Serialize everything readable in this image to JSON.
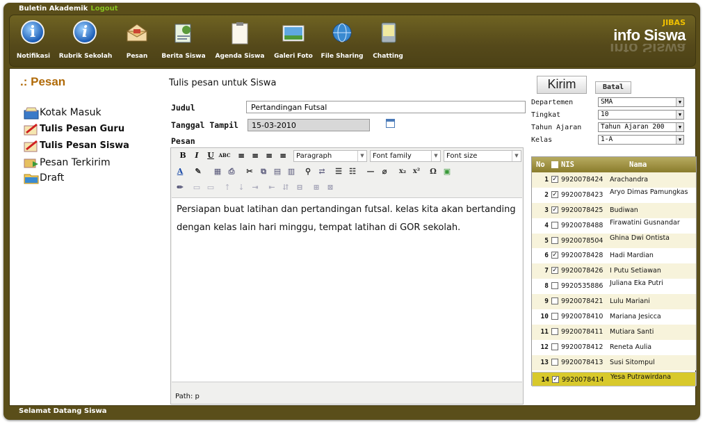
{
  "topbar": {
    "title": "Buletin Akademik",
    "logout": "Logout"
  },
  "toolbar": {
    "items": [
      {
        "label": "Notifikasi"
      },
      {
        "label": "Rubrik Sekolah"
      },
      {
        "label": "Pesan"
      },
      {
        "label": "Berita Siswa"
      },
      {
        "label": "Agenda Siswa"
      },
      {
        "label": "Galeri Foto"
      },
      {
        "label": "File Sharing"
      },
      {
        "label": "Chatting"
      }
    ],
    "brand_small": "JIBAS",
    "brand": "info Siswa"
  },
  "nav": {
    "title": ".: Pesan",
    "items": [
      {
        "label": "Kotak Masuk"
      },
      {
        "label": "Tulis Pesan Guru"
      },
      {
        "label": "Tulis Pesan Siswa"
      },
      {
        "label": "Pesan Terkirim"
      },
      {
        "label": "Draft"
      }
    ]
  },
  "form": {
    "heading": "Tulis pesan untuk Siswa",
    "judul_label": "Judul",
    "judul_value": "Pertandingan Futsal",
    "tanggal_label": "Tanggal Tampil",
    "tanggal_value": "15-03-2010",
    "pesan_label": "Pesan"
  },
  "editor": {
    "format_select": "Paragraph",
    "font_family_select": "Font family",
    "font_size_select": "Font size",
    "content": "Persiapan buat latihan dan pertandingan futsal. kelas kita akan bertanding dengan kelas lain hari minggu, tempat latihan di GOR sekolah.",
    "path": "Path: p"
  },
  "actions": {
    "send": "Kirim",
    "cancel": "Batal"
  },
  "filters": {
    "departemen_label": "Departemen",
    "departemen_value": "SMA",
    "tingkat_label": "Tingkat",
    "tingkat_value": "10",
    "tahun_label": "Tahun Ajaran",
    "tahun_value": "Tahun Ajaran 200",
    "kelas_label": "Kelas",
    "kelas_value": "1-A"
  },
  "students": {
    "headers": {
      "no": "No",
      "nis": "NIS",
      "nama": "Nama"
    },
    "rows": [
      {
        "no": "1",
        "checked": true,
        "nis": "9920078424",
        "nama": "Arachandra"
      },
      {
        "no": "2",
        "checked": true,
        "nis": "9920078423",
        "nama": "Aryo Dimas Pamungkas"
      },
      {
        "no": "3",
        "checked": true,
        "nis": "9920078425",
        "nama": "Budiwan"
      },
      {
        "no": "4",
        "checked": false,
        "nis": "9920078488",
        "nama": "Firawatini Gusnandar"
      },
      {
        "no": "5",
        "checked": false,
        "nis": "9920078504",
        "nama": "Ghina Dwi Ontista"
      },
      {
        "no": "6",
        "checked": true,
        "nis": "9920078428",
        "nama": "Hadi Mardian"
      },
      {
        "no": "7",
        "checked": true,
        "nis": "9920078426",
        "nama": "I Putu Setiawan"
      },
      {
        "no": "8",
        "checked": false,
        "nis": "9920535886",
        "nama": "Juliana Eka Putri"
      },
      {
        "no": "9",
        "checked": false,
        "nis": "9920078421",
        "nama": "Lulu Mariani"
      },
      {
        "no": "10",
        "checked": false,
        "nis": "9920078410",
        "nama": "Mariana Jesicca"
      },
      {
        "no": "11",
        "checked": false,
        "nis": "9920078411",
        "nama": "Mutiara Santi"
      },
      {
        "no": "12",
        "checked": false,
        "nis": "9920078412",
        "nama": "Reneta Aulia"
      },
      {
        "no": "13",
        "checked": false,
        "nis": "9920078413",
        "nama": "Susi Sitompul"
      },
      {
        "no": "14",
        "checked": true,
        "nis": "9920078414",
        "nama": "Yesa Putrawirdana"
      }
    ]
  },
  "footer": {
    "text": "Selamat Datang Siswa"
  },
  "colors": {
    "frame": "#5a4e1a",
    "header_accent": "#b06a08",
    "logout": "#86c21e",
    "selected_row": "#d8c92c"
  }
}
